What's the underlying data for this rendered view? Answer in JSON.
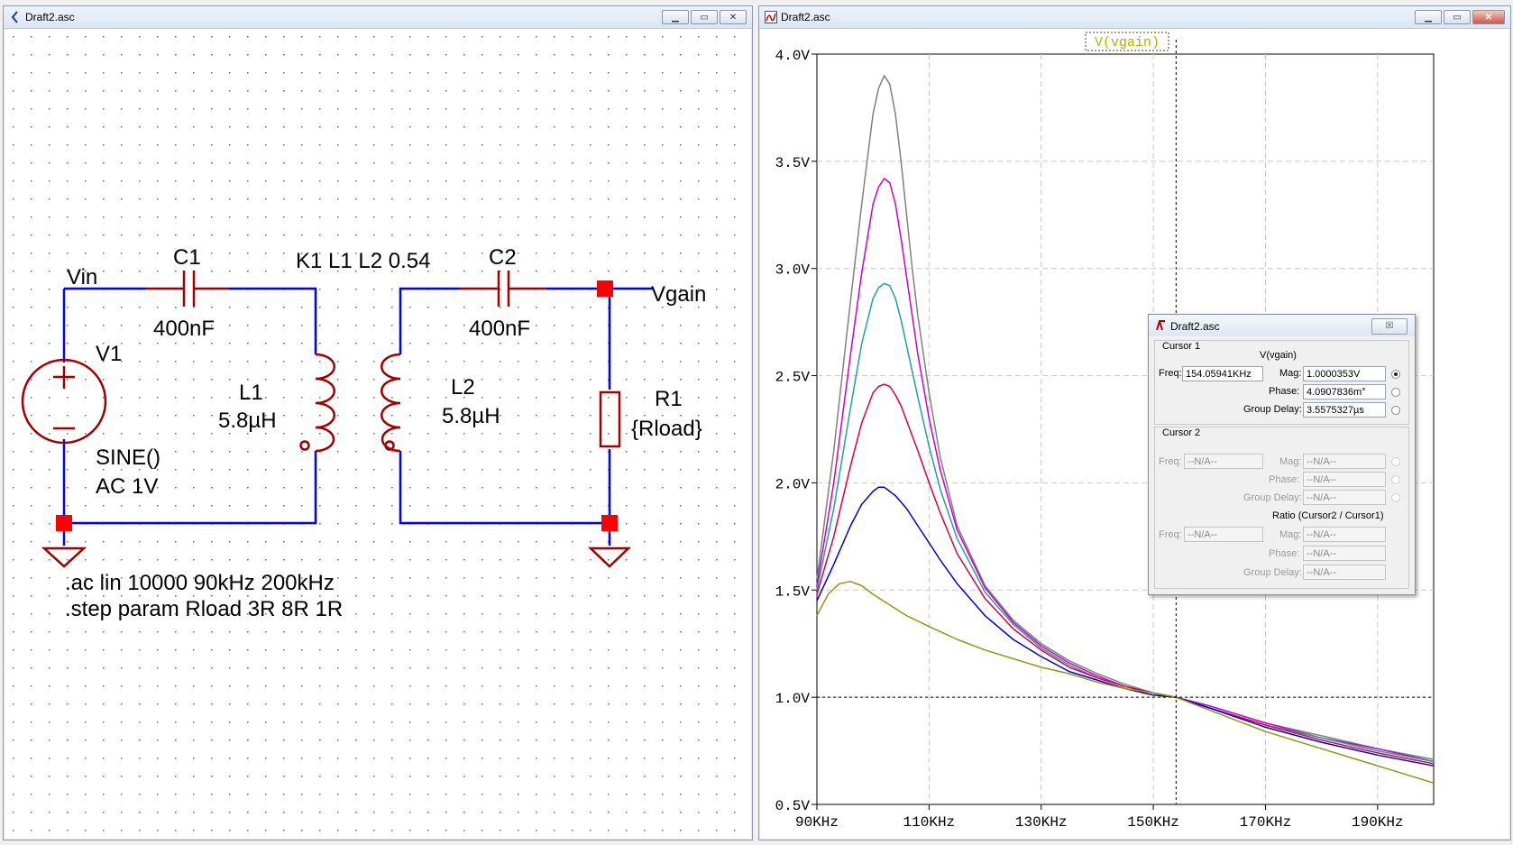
{
  "schematic_window": {
    "title": "Draft2.asc",
    "labels": {
      "vin": "Vin",
      "vgain": "Vgain",
      "c1_name": "C1",
      "c1_value": "400nF",
      "c2_name": "C2",
      "c2_value": "400nF",
      "k1": "K1 L1 L2 0.54",
      "v1_name": "V1",
      "v1_value1": "SINE()",
      "v1_value2": "AC 1V",
      "l1_name": "L1",
      "l1_value": "5.8µH",
      "l2_name": "L2",
      "l2_value": "5.8µH",
      "r1_name": "R1",
      "r1_value": "{Rload}",
      "directive1": ".ac lin 10000 90kHz 200kHz",
      "directive2": ".step param Rload 3R 8R 1R"
    }
  },
  "plot_window": {
    "title": "Draft2.asc",
    "trace_label": "V(vgain)"
  },
  "chart_data": {
    "type": "line",
    "title": "V(vgain)",
    "xlabel": "",
    "ylabel": "",
    "x_unit": "KHz",
    "xlim": [
      90,
      200
    ],
    "ylim": [
      0.5,
      4.0
    ],
    "x_ticks": [
      "90KHz",
      "110KHz",
      "130KHz",
      "150KHz",
      "170KHz",
      "190KHz"
    ],
    "y_ticks": [
      "0.5V",
      "1.0V",
      "1.5V",
      "2.0V",
      "2.5V",
      "3.0V",
      "3.5V",
      "4.0V"
    ],
    "grid": true,
    "cursor": {
      "x": 154.06,
      "y": 1.0
    },
    "series": [
      {
        "color": "#808080",
        "x": [
          90,
          93,
          96,
          98,
          100,
          101,
          102,
          103,
          104,
          105,
          106,
          107,
          108,
          110,
          112,
          115,
          120,
          125,
          130,
          135,
          140,
          145,
          150,
          154,
          160,
          170,
          180,
          190,
          200
        ],
        "values": [
          1.55,
          2.15,
          2.85,
          3.3,
          3.72,
          3.84,
          3.9,
          3.86,
          3.72,
          3.5,
          3.25,
          3.0,
          2.78,
          2.42,
          2.12,
          1.8,
          1.52,
          1.36,
          1.25,
          1.17,
          1.11,
          1.06,
          1.02,
          1.0,
          0.96,
          0.88,
          0.82,
          0.76,
          0.71
        ]
      },
      {
        "color": "#cc00cc",
        "x": [
          90,
          93,
          96,
          98,
          100,
          101,
          102,
          103,
          104,
          105,
          106,
          107,
          108,
          110,
          112,
          115,
          120,
          125,
          130,
          135,
          140,
          145,
          150,
          154,
          160,
          170,
          180,
          190,
          200
        ],
        "values": [
          1.52,
          2.0,
          2.6,
          2.98,
          3.3,
          3.38,
          3.42,
          3.4,
          3.3,
          3.14,
          2.96,
          2.78,
          2.6,
          2.3,
          2.06,
          1.78,
          1.51,
          1.35,
          1.24,
          1.16,
          1.1,
          1.05,
          1.02,
          1.0,
          0.96,
          0.88,
          0.81,
          0.76,
          0.7
        ]
      },
      {
        "color": "#20a0a0",
        "x": [
          90,
          93,
          96,
          98,
          100,
          101,
          102,
          103,
          104,
          105,
          106,
          107,
          108,
          110,
          112,
          115,
          120,
          125,
          130,
          135,
          140,
          145,
          150,
          154,
          160,
          170,
          180,
          190,
          200
        ],
        "values": [
          1.5,
          1.88,
          2.35,
          2.65,
          2.86,
          2.91,
          2.93,
          2.92,
          2.86,
          2.76,
          2.64,
          2.52,
          2.4,
          2.17,
          1.97,
          1.74,
          1.49,
          1.34,
          1.23,
          1.15,
          1.09,
          1.05,
          1.02,
          1.0,
          0.95,
          0.87,
          0.81,
          0.75,
          0.7
        ]
      },
      {
        "color": "#e00040",
        "x": [
          90,
          93,
          96,
          98,
          100,
          101,
          102,
          103,
          104,
          105,
          106,
          107,
          108,
          110,
          112,
          115,
          120,
          125,
          130,
          135,
          140,
          145,
          150,
          154,
          160,
          170,
          180,
          190,
          200
        ],
        "values": [
          1.48,
          1.75,
          2.08,
          2.28,
          2.42,
          2.45,
          2.46,
          2.45,
          2.41,
          2.36,
          2.29,
          2.22,
          2.15,
          2.0,
          1.86,
          1.67,
          1.46,
          1.32,
          1.22,
          1.14,
          1.09,
          1.05,
          1.02,
          1.0,
          0.95,
          0.87,
          0.8,
          0.74,
          0.69
        ]
      },
      {
        "color": "#0000cc",
        "x": [
          90,
          93,
          96,
          98,
          100,
          101,
          102,
          103,
          104,
          105,
          106,
          107,
          108,
          110,
          112,
          115,
          120,
          125,
          130,
          135,
          140,
          145,
          150,
          154,
          160,
          170,
          180,
          190,
          200
        ],
        "values": [
          1.45,
          1.62,
          1.8,
          1.9,
          1.96,
          1.98,
          1.98,
          1.96,
          1.94,
          1.91,
          1.88,
          1.84,
          1.8,
          1.72,
          1.64,
          1.53,
          1.38,
          1.27,
          1.19,
          1.12,
          1.08,
          1.04,
          1.01,
          1.0,
          0.95,
          0.86,
          0.79,
          0.73,
          0.68
        ]
      },
      {
        "color": "#8c9a10",
        "x": [
          90,
          92,
          94,
          96,
          98,
          100,
          103,
          106,
          110,
          115,
          120,
          125,
          130,
          135,
          140,
          145,
          150,
          154,
          160,
          170,
          180,
          190,
          200
        ],
        "values": [
          1.38,
          1.48,
          1.53,
          1.54,
          1.52,
          1.48,
          1.43,
          1.38,
          1.33,
          1.27,
          1.22,
          1.18,
          1.14,
          1.11,
          1.07,
          1.04,
          1.02,
          1.0,
          0.94,
          0.84,
          0.76,
          0.68,
          0.6
        ]
      }
    ]
  },
  "cursor_dialog": {
    "title": "Draft2.asc",
    "close_glyph": "☒",
    "cursor1_header": "Cursor 1",
    "trace_name": "V(vgain)",
    "freq_label": "Freq:",
    "freq_value": "154.05941KHz",
    "mag_label": "Mag:",
    "mag_value": "1.0000353V",
    "phase_label": "Phase:",
    "phase_value": "4.0907836m°",
    "group_delay_label": "Group Delay:",
    "group_delay_value": "3.5575327µs",
    "cursor2_header": "Cursor 2",
    "c2_freq": "--N/A--",
    "c2_mag": "--N/A--",
    "c2_phase": "--N/A--",
    "c2_group_delay": "--N/A--",
    "ratio_header": "Ratio (Cursor2 / Cursor1)",
    "r_freq": "--N/A--",
    "r_mag": "--N/A--",
    "r_phase": "--N/A--",
    "r_group_delay": "--N/A--"
  },
  "colors": {
    "wire": "#0000ff",
    "component": "#a00000",
    "node": "#ff0000",
    "trace_label": "#b3b300"
  },
  "icons": [
    "schematic-icon",
    "waveform-icon",
    "ltspice-icon",
    "minimize-icon",
    "restore-icon",
    "close-icon"
  ]
}
